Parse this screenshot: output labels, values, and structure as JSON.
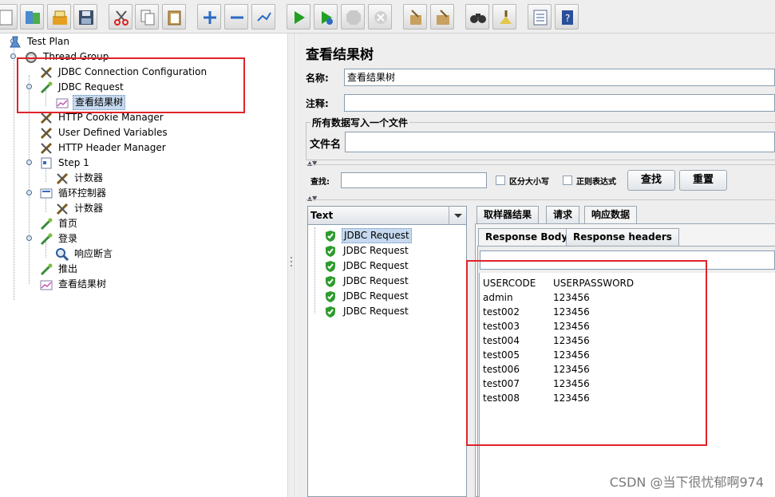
{
  "toolbar": {
    "buttons": [
      "new-icon",
      "templates-icon",
      "open-icon",
      "save-icon",
      "cut-icon",
      "copy-icon",
      "paste-icon",
      "expand-icon",
      "collapse-icon",
      "toggle-icon",
      "start-icon",
      "start-no-pauses-icon",
      "stop-icon",
      "shutdown-icon",
      "clear-icon",
      "clear-all-icon",
      "search-icon",
      "reset-search-icon",
      "function-helper-icon",
      "help-icon"
    ]
  },
  "tree": {
    "items": [
      {
        "label": "Test Plan",
        "icon": "test-plan-icon"
      },
      {
        "label": "Thread Group",
        "icon": "thread-group-icon"
      },
      {
        "label": "JDBC Connection Configuration",
        "icon": "config-element-icon"
      },
      {
        "label": "JDBC Request",
        "icon": "sampler-icon"
      },
      {
        "label": "查看结果树",
        "icon": "listener-icon"
      },
      {
        "label": "HTTP Cookie Manager",
        "icon": "config-element-icon"
      },
      {
        "label": "User Defined Variables",
        "icon": "config-element-icon"
      },
      {
        "label": "HTTP Header Manager",
        "icon": "config-element-icon"
      },
      {
        "label": "Step 1",
        "icon": "controller-icon"
      },
      {
        "label": "计数器",
        "icon": "config-element-icon"
      },
      {
        "label": "循环控制器",
        "icon": "loop-controller-icon"
      },
      {
        "label": "计数器",
        "icon": "config-element-icon"
      },
      {
        "label": "首页",
        "icon": "sampler-icon"
      },
      {
        "label": "登录",
        "icon": "sampler-icon"
      },
      {
        "label": "响应断言",
        "icon": "assertion-icon"
      },
      {
        "label": "推出",
        "icon": "sampler-icon"
      },
      {
        "label": "查看结果树",
        "icon": "listener-icon"
      }
    ]
  },
  "panel": {
    "title": "查看结果树",
    "name_label": "名称:",
    "name_value": "查看结果树",
    "comment_label": "注释:",
    "comment_value": "",
    "file_section": "所有数据写入一个文件",
    "file_label": "文件名",
    "file_value": ""
  },
  "search": {
    "label": "查找:",
    "value": "",
    "case_sensitive": "区分大小写",
    "regex": "正则表达式",
    "find_button": "查找",
    "reset_button": "重置"
  },
  "results": {
    "renderer": "Text",
    "items": [
      "JDBC Request",
      "JDBC Request",
      "JDBC Request",
      "JDBC Request",
      "JDBC Request",
      "JDBC Request"
    ]
  },
  "tabs": {
    "top": [
      "取样器结果",
      "请求",
      "响应数据"
    ],
    "sub": [
      "Response Body",
      "Response headers"
    ]
  },
  "response": {
    "rows": [
      [
        "USERCODE",
        "USERPASSWORD"
      ],
      [
        "admin",
        "123456"
      ],
      [
        "test002",
        "123456"
      ],
      [
        "test003",
        "123456"
      ],
      [
        "test004",
        "123456"
      ],
      [
        "test005",
        "123456"
      ],
      [
        "test006",
        "123456"
      ],
      [
        "test007",
        "123456"
      ],
      [
        "test008",
        "123456"
      ]
    ]
  },
  "watermark": "CSDN @当下很忧郁啊974",
  "colors": {
    "highlight_rect": "#e0232a",
    "selection": "#c6d9ee",
    "success": "#2e9b2e"
  }
}
